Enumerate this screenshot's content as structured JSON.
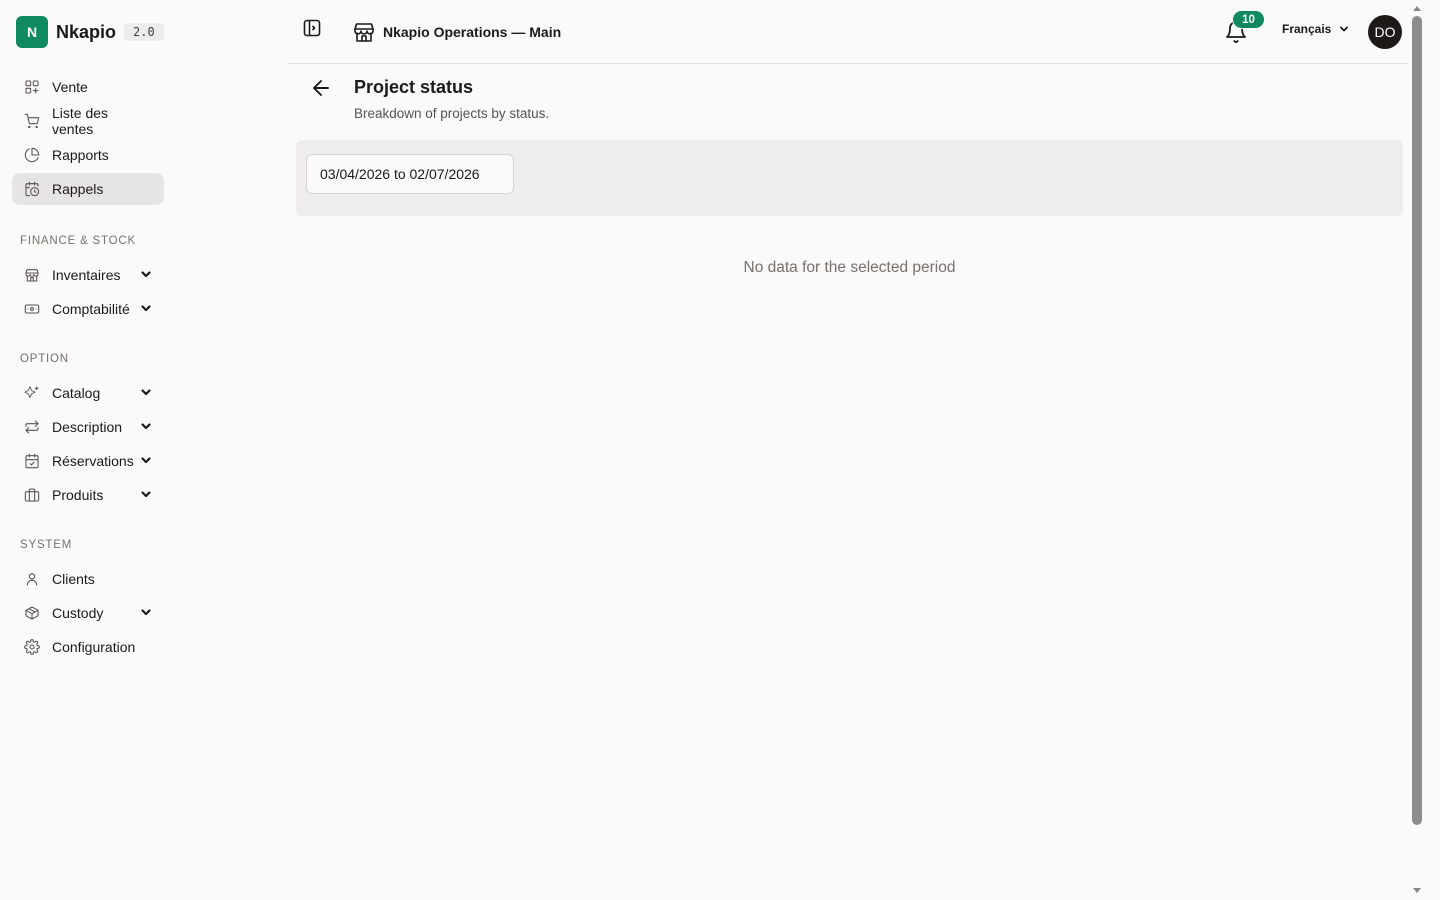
{
  "brand": {
    "logo_letter": "N",
    "name": "Nkapio",
    "version": "2.0",
    "color": "#0f8a5f"
  },
  "sidebar": {
    "top_items": [
      {
        "label": "Vente",
        "icon": "layout-grid-plus-icon"
      },
      {
        "label": "Liste des ventes",
        "icon": "shopping-cart-icon"
      },
      {
        "label": "Rapports",
        "icon": "pie-chart-icon"
      },
      {
        "label": "Rappels",
        "icon": "calendar-clock-icon",
        "active": true
      }
    ],
    "sections": [
      {
        "title": "FINANCE & STOCK",
        "items": [
          {
            "label": "Inventaires",
            "icon": "store-icon",
            "expandable": true
          },
          {
            "label": "Comptabilité",
            "icon": "banknote-icon",
            "expandable": true
          }
        ]
      },
      {
        "title": "OPTION",
        "items": [
          {
            "label": "Catalog",
            "icon": "sparkles-icon",
            "expandable": true
          },
          {
            "label": "Description",
            "icon": "arrows-exchange-icon",
            "expandable": true
          },
          {
            "label": "Réservations",
            "icon": "calendar-check-icon",
            "expandable": true
          },
          {
            "label": "Produits",
            "icon": "boxes-icon",
            "expandable": true
          }
        ]
      },
      {
        "title": "SYSTEM",
        "items": [
          {
            "label": "Clients",
            "icon": "user-icon",
            "expandable": false
          },
          {
            "label": "Custody",
            "icon": "package-icon",
            "expandable": true
          },
          {
            "label": "Configuration",
            "icon": "gear-icon",
            "expandable": false
          }
        ]
      }
    ]
  },
  "topbar": {
    "org_name": "Nkapio Operations — Main",
    "notifications_count": "10",
    "language": "Français",
    "avatar_initials": "DO"
  },
  "page": {
    "title": "Project status",
    "subtitle": "Breakdown of projects by status.",
    "date_range": "03/04/2026 to 02/07/2026",
    "empty_message": "No data for the selected period"
  }
}
